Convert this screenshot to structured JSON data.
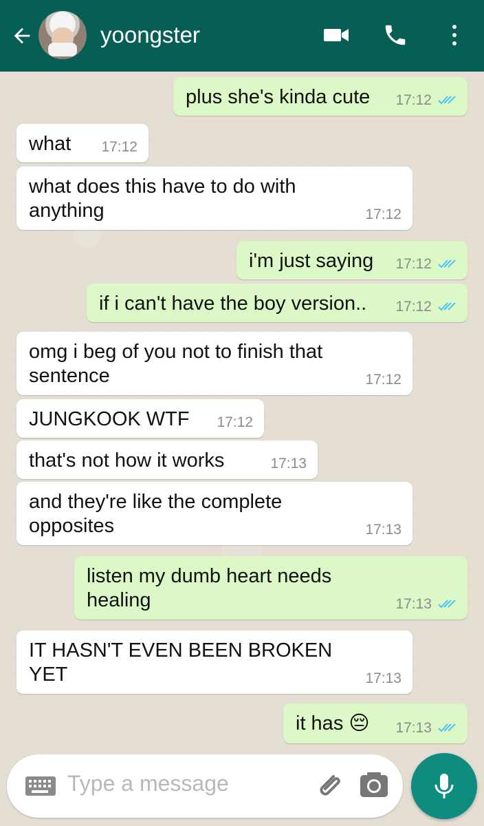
{
  "header": {
    "contact_name": "yoongster",
    "icons": [
      "arrow-left-icon",
      "video-call-icon",
      "phone-icon",
      "more-vertical-icon"
    ]
  },
  "messages": [
    {
      "direction": "out",
      "text": "plus she's kinda cute",
      "time": "17:12",
      "status": "read"
    },
    {
      "direction": "in",
      "text": "what",
      "time": "17:12"
    },
    {
      "direction": "in",
      "text": "what does this have to do with\nanything",
      "time": "17:12"
    },
    {
      "direction": "out",
      "text": "i'm just saying",
      "time": "17:12",
      "status": "read"
    },
    {
      "direction": "out",
      "text": "if i can't have the boy version..",
      "time": "17:12",
      "status": "read"
    },
    {
      "direction": "in",
      "text": "omg i beg of you not to finish that\nsentence",
      "time": "17:12"
    },
    {
      "direction": "in",
      "text": "JUNGKOOK WTF",
      "time": "17:12"
    },
    {
      "direction": "in",
      "text": "that's not how it works",
      "time": "17:13"
    },
    {
      "direction": "in",
      "text": "and they're like the complete\nopposites",
      "time": "17:13"
    },
    {
      "direction": "out",
      "text": "listen my dumb heart needs\nhealing",
      "time": "17:13",
      "status": "read"
    },
    {
      "direction": "in",
      "text": "IT HASN'T EVEN BEEN BROKEN\nYET",
      "time": "17:13"
    },
    {
      "direction": "out",
      "text": "it has 😔",
      "time": "17:13",
      "status": "read"
    }
  ],
  "composer": {
    "placeholder": "Type a message",
    "icons": [
      "keyboard-icon",
      "paperclip-icon",
      "camera-icon",
      "microphone-icon"
    ]
  },
  "colors": {
    "header": "#075e54",
    "incoming_bubble": "#ffffff",
    "outgoing_bubble": "#dcf8c6",
    "read_check": "#4fc3f7",
    "mic_button": "#0f8c80"
  }
}
